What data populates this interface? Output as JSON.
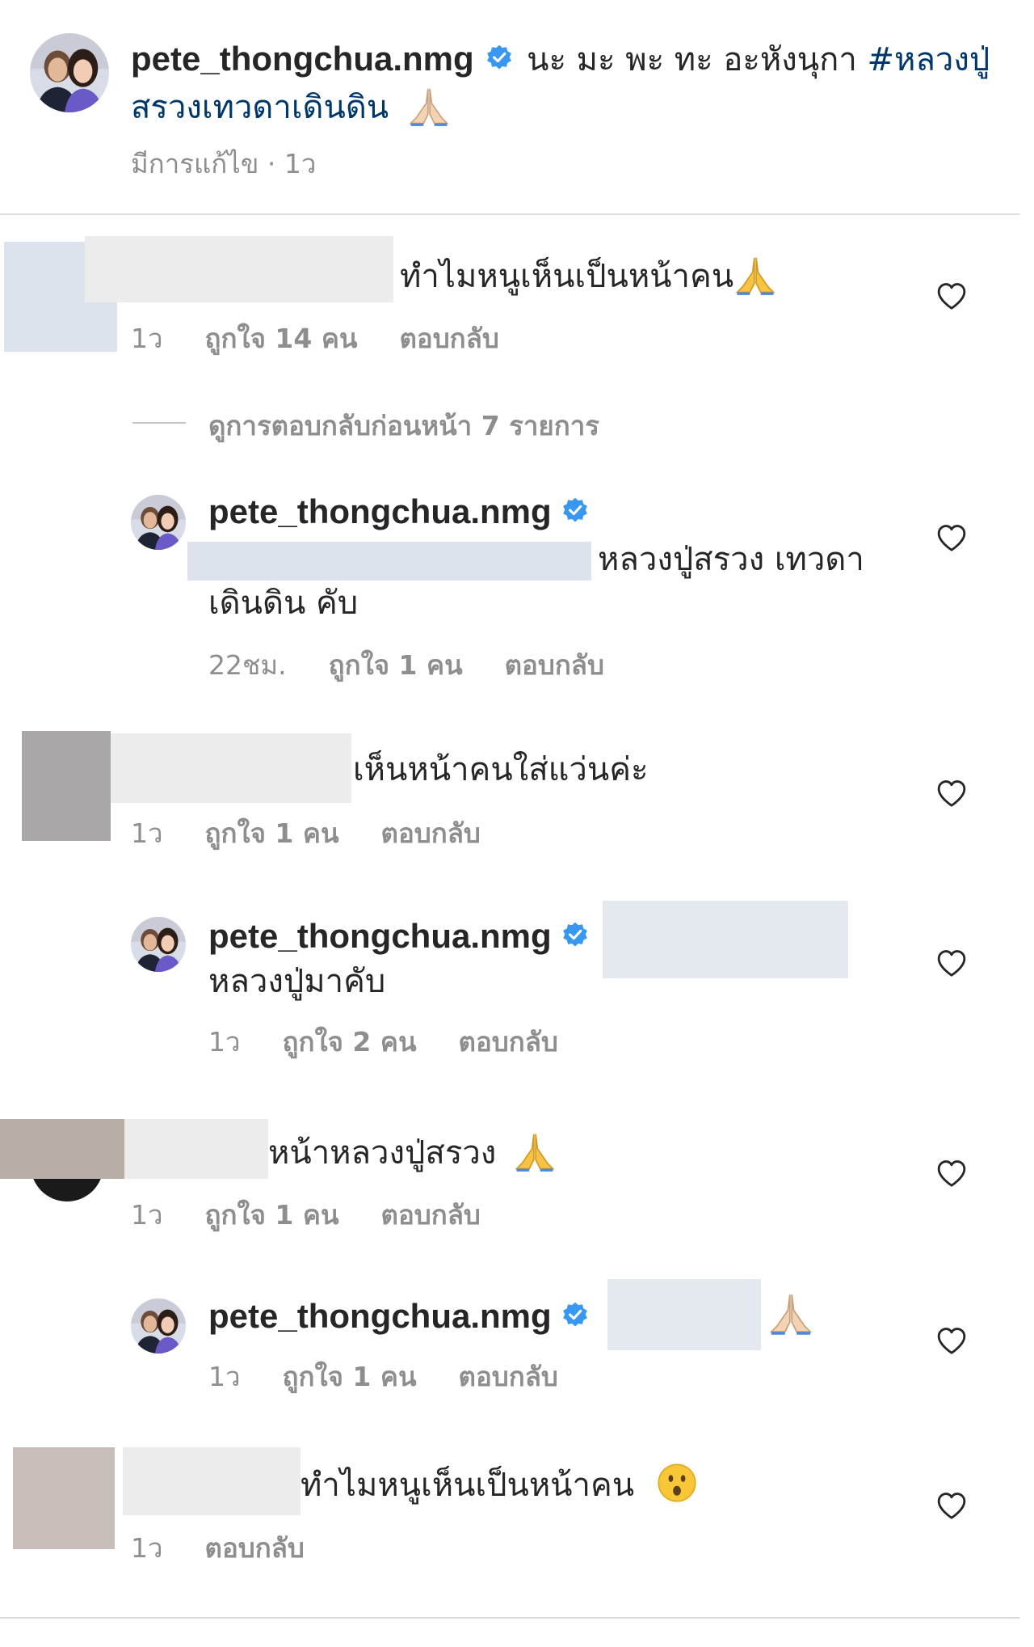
{
  "post": {
    "username": "pete_thongchua.nmg",
    "caption": "นะ มะ พะ ทะ อะหังนุกา",
    "hashtag_line1": "#หลวงปู่",
    "hashtag_line2": "สรวงเทวดาเดินดิน",
    "caption_emoji": "folded-hands",
    "meta": "มีการแก้ไข · 1ว"
  },
  "comments": [
    {
      "text": "ทำไมหนูเห็นเป็นหน้าคน",
      "emoji": "folded-hands",
      "time": "1ว",
      "likes": "ถูกใจ 14 คน",
      "reply": "ตอบกลับ",
      "view_replies": "ดูการตอบกลับก่อนหน้า 7 รายการ"
    },
    {
      "username": "pete_thongchua.nmg",
      "text_line1": "หลวงปู่สรวง เทวดา",
      "text_line2": "เดินดิน คับ",
      "time": "22ชม.",
      "likes": "ถูกใจ 1 คน",
      "reply": "ตอบกลับ"
    },
    {
      "text": "เห็นหน้าคนใส่แว่นค่ะ",
      "time": "1ว",
      "likes": "ถูกใจ 1 คน",
      "reply": "ตอบกลับ"
    },
    {
      "username": "pete_thongchua.nmg",
      "text": "หลวงปู่มาคับ",
      "time": "1ว",
      "likes": "ถูกใจ 2 คน",
      "reply": "ตอบกลับ"
    },
    {
      "text": "หน้าหลวงปู่สรวง",
      "emoji": "folded-hands",
      "time": "1ว",
      "likes": "ถูกใจ 1 คน",
      "reply": "ตอบกลับ"
    },
    {
      "username": "pete_thongchua.nmg",
      "emoji": "folded-hands-light",
      "time": "1ว",
      "likes": "ถูกใจ 1 คน",
      "reply": "ตอบกลับ"
    },
    {
      "text": "ทำไมหนูเห็นเป็นหน้าคน",
      "emoji": "hushed-face",
      "time": "1ว",
      "reply": "ตอบกลับ"
    }
  ],
  "colors": {
    "verified": "#3897f0",
    "hashtag": "#00376b",
    "meta": "#8e8e8e",
    "text": "#262626"
  }
}
